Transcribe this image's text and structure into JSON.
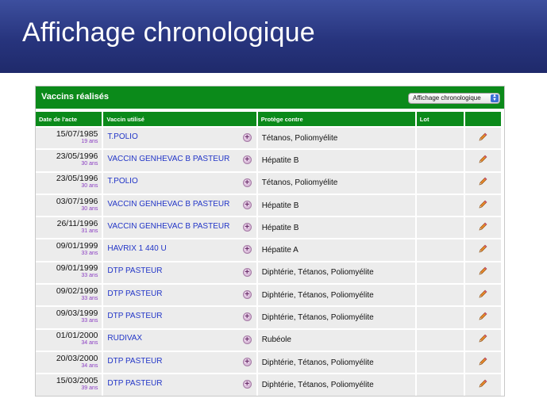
{
  "page": {
    "title": "Affichage chronologique"
  },
  "panel": {
    "title": "Vaccins réalisés",
    "view_select": {
      "selected": "Affichage chronologique"
    }
  },
  "table": {
    "columns": [
      "Date de l'acte",
      "Vaccin utilisé",
      "Protège contre",
      "Lot",
      ""
    ],
    "rows": [
      {
        "date": "15/07/1985",
        "age": "19 ans",
        "vaccine": "T.POLIO",
        "protects": "Tétanos, Poliomyélite",
        "lot": ""
      },
      {
        "date": "23/05/1996",
        "age": "30 ans",
        "vaccine": "VACCIN GENHEVAC B PASTEUR",
        "protects": "Hépatite B",
        "lot": ""
      },
      {
        "date": "23/05/1996",
        "age": "30 ans",
        "vaccine": "T.POLIO",
        "protects": "Tétanos, Poliomyélite",
        "lot": ""
      },
      {
        "date": "03/07/1996",
        "age": "30 ans",
        "vaccine": "VACCIN GENHEVAC B PASTEUR",
        "protects": "Hépatite B",
        "lot": ""
      },
      {
        "date": "26/11/1996",
        "age": "31 ans",
        "vaccine": "VACCIN GENHEVAC B PASTEUR",
        "protects": "Hépatite B",
        "lot": ""
      },
      {
        "date": "09/01/1999",
        "age": "33 ans",
        "vaccine": "HAVRIX 1 440 U",
        "protects": "Hépatite A",
        "lot": ""
      },
      {
        "date": "09/01/1999",
        "age": "33 ans",
        "vaccine": "DTP PASTEUR",
        "protects": "Diphtérie, Tétanos, Poliomyélite",
        "lot": ""
      },
      {
        "date": "09/02/1999",
        "age": "33 ans",
        "vaccine": "DTP PASTEUR",
        "protects": "Diphtérie, Tétanos, Poliomyélite",
        "lot": ""
      },
      {
        "date": "09/03/1999",
        "age": "33 ans",
        "vaccine": "DTP PASTEUR",
        "protects": "Diphtérie, Tétanos, Poliomyélite",
        "lot": ""
      },
      {
        "date": "01/01/2000",
        "age": "34 ans",
        "vaccine": "RUDIVAX",
        "protects": "Rubéole",
        "lot": ""
      },
      {
        "date": "20/03/2000",
        "age": "34 ans",
        "vaccine": "DTP PASTEUR",
        "protects": "Diphtérie, Tétanos, Poliomyélite",
        "lot": ""
      },
      {
        "date": "15/03/2005",
        "age": "39 ans",
        "vaccine": "DTP PASTEUR",
        "protects": "Diphtérie, Tétanos, Poliomyélite",
        "lot": ""
      }
    ]
  },
  "icons": {
    "add": "plus-circle-icon",
    "edit": "pencil-icon",
    "select": "select-arrows-icon"
  },
  "colors": {
    "header_green": "#0b8a1a",
    "banner_blue": "#27347d",
    "link_blue": "#2235c7",
    "age_purple": "#8a3cc2"
  }
}
